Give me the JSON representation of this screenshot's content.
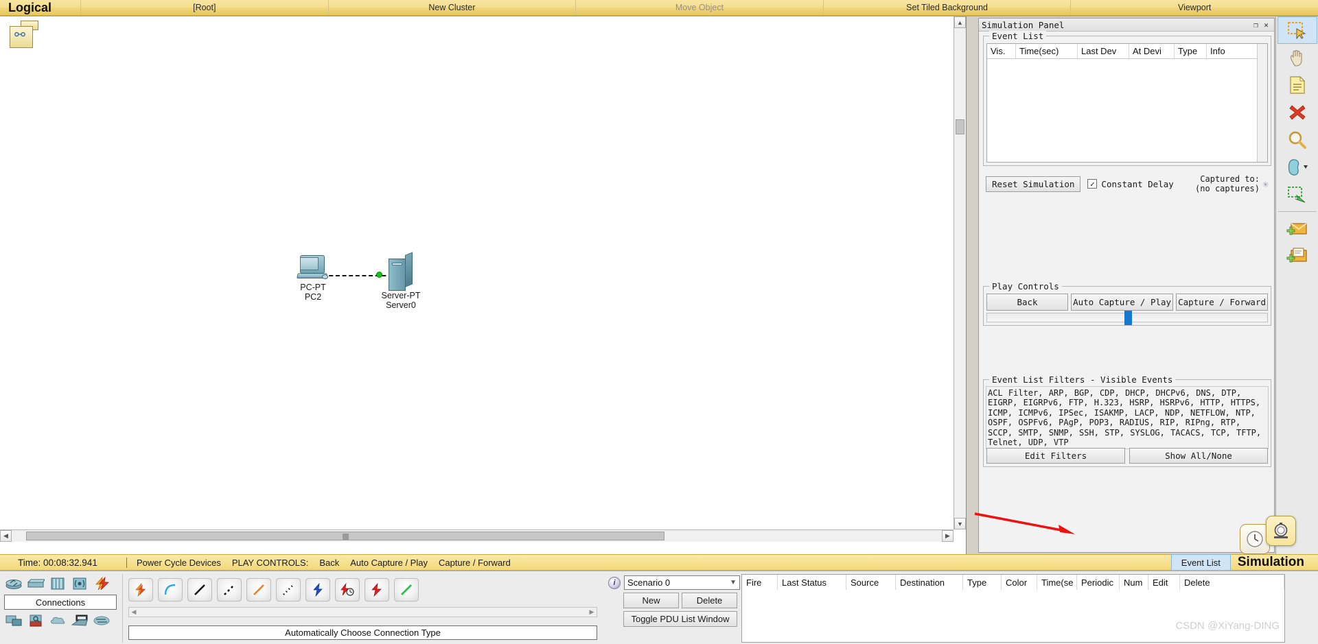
{
  "topbar": {
    "mode_label": "Logical",
    "cells": [
      {
        "label": "[Root]",
        "dim": false
      },
      {
        "label": "New Cluster",
        "dim": false
      },
      {
        "label": "Move Object",
        "dim": true
      },
      {
        "label": "Set Tiled Background",
        "dim": false
      },
      {
        "label": "Viewport",
        "dim": false
      }
    ]
  },
  "canvas": {
    "devices": [
      {
        "model": "PC-PT",
        "name": "PC2"
      },
      {
        "model": "Server-PT",
        "name": "Server0"
      }
    ],
    "link_status_color": "#15c415"
  },
  "simulation_panel": {
    "title": "Simulation Panel",
    "restore_glyph": "❐",
    "close_glyph": "✕",
    "event_list": {
      "legend": "Event List",
      "columns": [
        "Vis.",
        "Time(sec)",
        "Last Dev",
        "At Devi",
        "Type",
        "Info"
      ],
      "rows": []
    },
    "controls": {
      "reset_label": "Reset Simulation",
      "constant_delay_label": "Constant Delay",
      "constant_delay_checked": true,
      "captured_line1": "Captured to:",
      "captured_line2": "(no captures)",
      "captured_marker": "✳"
    },
    "play_controls": {
      "legend": "Play Controls",
      "buttons": [
        "Back",
        "Auto Capture / Play",
        "Capture / Forward"
      ],
      "slider_position_percent": 49,
      "slider_color": "#1878d0"
    },
    "filters": {
      "legend": "Event List Filters - Visible Events",
      "protocols": "ACL Filter, ARP, BGP, CDP, DHCP, DHCPv6, DNS, DTP, EIGRP, EIGRPv6, FTP, H.323, HSRP, HSRPv6, HTTP, HTTPS, ICMP, ICMPv6, IPSec, ISAKMP, LACP, NDP, NETFLOW, NTP, OSPF, OSPFv6, PAgP, POP3, RADIUS, RIP, RIPng, RTP, SCCP, SMTP, SNMP, SSH, STP, SYSLOG, TACACS, TCP, TFTP, Telnet, UDP, VTP",
      "edit_label": "Edit Filters",
      "showall_label": "Show All/None"
    }
  },
  "right_toolbar": {
    "tools": [
      {
        "name": "select-tool",
        "selected": true
      },
      {
        "name": "move-layout-tool",
        "selected": false
      },
      {
        "name": "place-note-tool",
        "selected": false
      },
      {
        "name": "delete-tool",
        "selected": false
      },
      {
        "name": "inspect-tool",
        "selected": false
      },
      {
        "name": "draw-shape-tool",
        "selected": false
      },
      {
        "name": "resize-shape-tool",
        "selected": false
      },
      {
        "name": "add-simple-pdu-tool",
        "selected": false
      },
      {
        "name": "add-complex-pdu-tool",
        "selected": false
      }
    ]
  },
  "statusbar": {
    "time": "Time: 00:08:32.941",
    "power_cycle": "Power Cycle Devices",
    "play_controls_label": "PLAY CONTROLS:",
    "back": "Back",
    "auto_capture": "Auto Capture / Play",
    "capture_forward": "Capture / Forward",
    "event_list_tab": "Event List",
    "mode_label": "Simulation"
  },
  "device_panel": {
    "connections_label": "Connections",
    "category_row1": [
      "router-icon",
      "switch-icon",
      "hub-icon",
      "wireless-icon",
      "connections-icon"
    ],
    "category_row2": [
      "end-devices-icon",
      "security-icon",
      "wan-emulation-icon",
      "multiuser-icon",
      "custom-made-icon"
    ]
  },
  "connection_panel": {
    "choose_label": "Automatically Choose Connection Type",
    "types": [
      "auto-connection-icon",
      "console-connection-icon",
      "copper-straight-icon",
      "copper-crossover-icon",
      "fiber-connection-icon",
      "phone-connection-icon",
      "coaxial-connection-icon",
      "serial-dce-icon",
      "serial-dte-icon",
      "octal-connection-icon"
    ]
  },
  "pdu_panel": {
    "scenario_value": "Scenario 0",
    "new_label": "New",
    "delete_label": "Delete",
    "toggle_label": "Toggle PDU List Window",
    "columns": [
      "Fire",
      "Last Status",
      "Source",
      "Destination",
      "Type",
      "Color",
      "Time(se",
      "Periodic",
      "Num",
      "Edit",
      "Delete"
    ],
    "rows": []
  },
  "watermark": "CSDN @XiYang-DING"
}
